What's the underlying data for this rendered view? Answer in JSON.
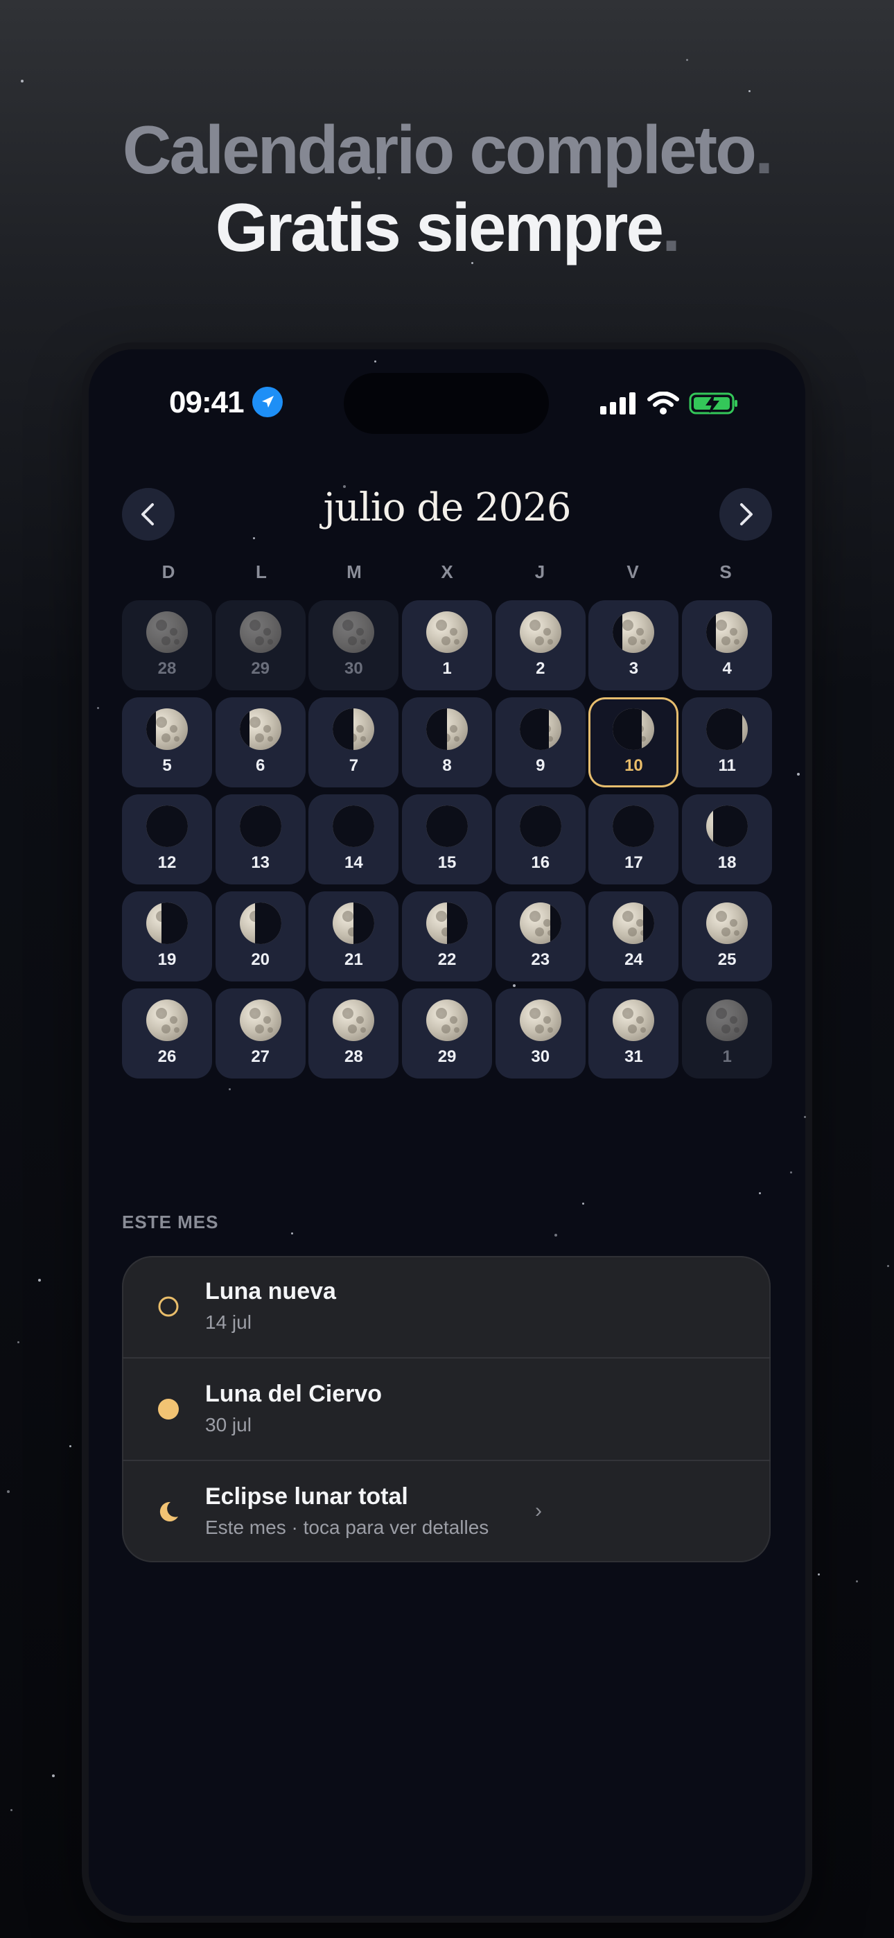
{
  "headline": {
    "line1": "Calendario completo",
    "line2": "Gratis siempre",
    "period": "."
  },
  "status_bar": {
    "time": "09:41"
  },
  "calendar": {
    "month_title": "julio de 2026",
    "weekdays": [
      "D",
      "L",
      "M",
      "X",
      "J",
      "V",
      "S"
    ],
    "days": [
      {
        "n": "28",
        "out": true,
        "phase": "full"
      },
      {
        "n": "29",
        "out": true,
        "phase": "full"
      },
      {
        "n": "30",
        "out": true,
        "phase": "full"
      },
      {
        "n": "1",
        "phase": "full"
      },
      {
        "n": "2",
        "phase": "full"
      },
      {
        "n": "3",
        "phase": "waning-gibbous"
      },
      {
        "n": "4",
        "phase": "waning-gibbous"
      },
      {
        "n": "5",
        "phase": "waning-gibbous"
      },
      {
        "n": "6",
        "phase": "waning-gibbous"
      },
      {
        "n": "7",
        "phase": "last-quarter"
      },
      {
        "n": "8",
        "phase": "last-quarter"
      },
      {
        "n": "9",
        "phase": "waning-crescent"
      },
      {
        "n": "10",
        "today": true,
        "phase": "waning-crescent"
      },
      {
        "n": "11",
        "phase": "thin-crescent"
      },
      {
        "n": "12",
        "phase": "new"
      },
      {
        "n": "13",
        "phase": "new"
      },
      {
        "n": "14",
        "phase": "new"
      },
      {
        "n": "15",
        "phase": "new"
      },
      {
        "n": "16",
        "phase": "new"
      },
      {
        "n": "17",
        "phase": "new"
      },
      {
        "n": "18",
        "phase": "waxing-thin"
      },
      {
        "n": "19",
        "phase": "waxing-crescent"
      },
      {
        "n": "20",
        "phase": "waxing-crescent"
      },
      {
        "n": "21",
        "phase": "first-quarter"
      },
      {
        "n": "22",
        "phase": "first-quarter"
      },
      {
        "n": "23",
        "phase": "waxing-gibbous"
      },
      {
        "n": "24",
        "phase": "waxing-gibbous"
      },
      {
        "n": "25",
        "phase": "full"
      },
      {
        "n": "26",
        "phase": "full"
      },
      {
        "n": "27",
        "phase": "full"
      },
      {
        "n": "28",
        "phase": "full"
      },
      {
        "n": "29",
        "phase": "full"
      },
      {
        "n": "30",
        "phase": "full"
      },
      {
        "n": "31",
        "phase": "full"
      },
      {
        "n": "1",
        "out": true,
        "phase": "full"
      }
    ]
  },
  "this_month": {
    "label": "ESTE MES",
    "events": [
      {
        "title": "Luna nueva",
        "subtitle": "14 jul",
        "icon": "new-moon-ring-icon"
      },
      {
        "title": "Luna del Ciervo",
        "subtitle": "30 jul",
        "icon": "full-moon-dot-icon"
      },
      {
        "title": "Eclipse lunar total",
        "subtitle": "Este mes · toca para ver detalles",
        "icon": "crescent-moon-icon",
        "chevron": "›"
      }
    ]
  },
  "colors": {
    "accent": "#E9BD6A",
    "phone_bg": "#0A0C16",
    "cell": "#1F2438",
    "location": "#1E8FF6",
    "battery": "#34C759"
  }
}
